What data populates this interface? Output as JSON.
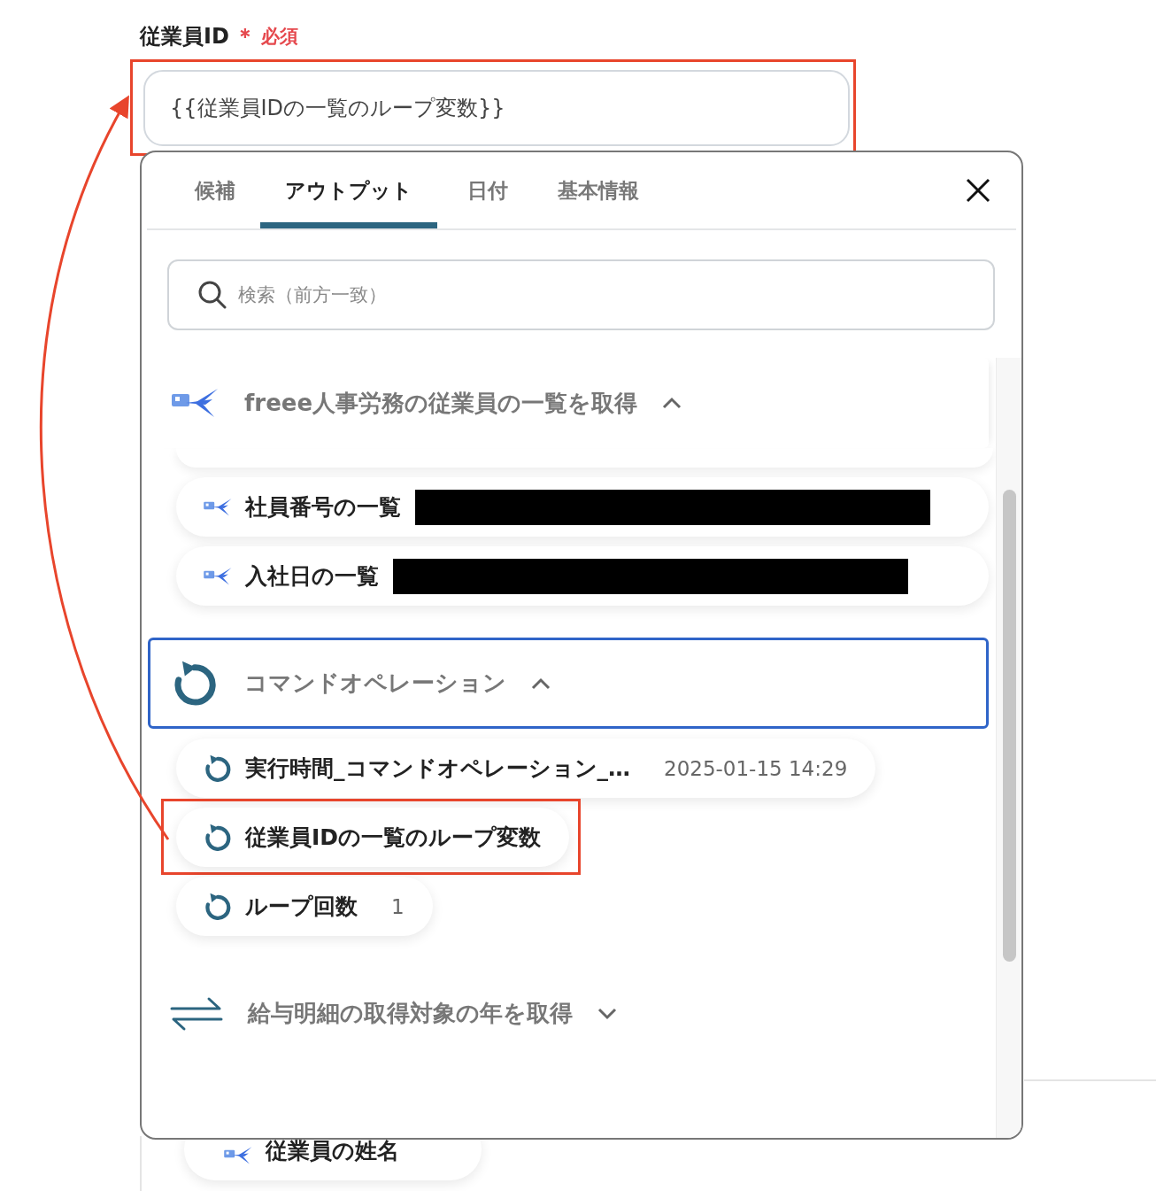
{
  "field": {
    "label": "従業員ID",
    "required_mark": "＊",
    "required_label": "必須",
    "value": "{{従業員IDの一覧のループ変数}}",
    "highlighted": true
  },
  "picker": {
    "tabs": [
      {
        "label": "候補",
        "selected": false
      },
      {
        "label": "アウトプット",
        "selected": true
      },
      {
        "label": "日付",
        "selected": false
      },
      {
        "label": "基本情報",
        "selected": false
      }
    ],
    "search": {
      "placeholder": "検索（前方一致）"
    },
    "groups": [
      {
        "title": "freee人事労務の従業員の一覧を取得",
        "kind": "freee",
        "expanded": true,
        "focused": false,
        "items": [
          {
            "label": "社員番号の一覧",
            "redacted": true,
            "highlighted": false
          },
          {
            "label": "入社日の一覧",
            "redacted": true,
            "highlighted": false
          }
        ]
      },
      {
        "title": "コマンドオペレーション",
        "kind": "loop",
        "expanded": true,
        "focused": true,
        "items": [
          {
            "label": "実行時間_コマンドオペレーション_…",
            "value": "2025-01-15 14:29",
            "redacted": false,
            "highlighted": false
          },
          {
            "label": "従業員IDの一覧のループ変数",
            "redacted": false,
            "highlighted": true
          },
          {
            "label": "ループ回数",
            "value": "1",
            "redacted": false,
            "highlighted": false
          }
        ]
      },
      {
        "title": "給与明細の取得対象の年を取得",
        "kind": "transfer",
        "expanded": false,
        "focused": false
      }
    ]
  },
  "background_item": {
    "label": "従業員の姓名",
    "kind": "freee"
  }
}
